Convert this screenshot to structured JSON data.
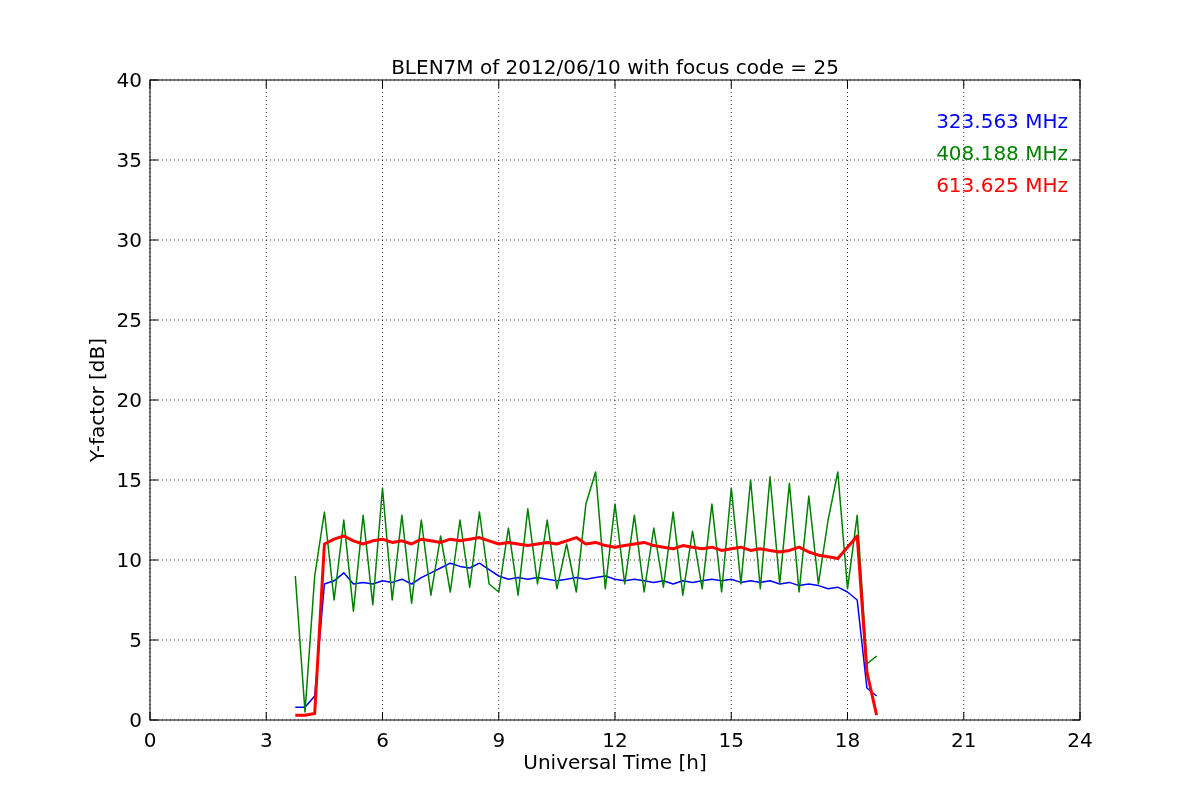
{
  "chart_data": {
    "type": "line",
    "title": "BLEN7M of 2012/06/10 with focus code = 25",
    "xlabel": "Universal Time [h]",
    "ylabel": "Y-factor [dB]",
    "x": [
      3.75,
      4.0,
      4.25,
      4.5,
      4.75,
      5.0,
      5.25,
      5.5,
      5.75,
      6.0,
      6.25,
      6.5,
      6.75,
      7.0,
      7.25,
      7.5,
      7.75,
      8.0,
      8.25,
      8.5,
      8.75,
      9.0,
      9.25,
      9.5,
      9.75,
      10.0,
      10.25,
      10.5,
      10.75,
      11.0,
      11.25,
      11.5,
      11.75,
      12.0,
      12.25,
      12.5,
      12.75,
      13.0,
      13.25,
      13.5,
      13.75,
      14.0,
      14.25,
      14.5,
      14.75,
      15.0,
      15.25,
      15.5,
      15.75,
      16.0,
      16.25,
      16.5,
      16.75,
      17.0,
      17.25,
      17.5,
      17.75,
      18.0,
      18.25,
      18.5,
      18.75
    ],
    "series": [
      {
        "name": "323.563 MHz",
        "color": "#0000ff",
        "values": [
          0.8,
          0.8,
          1.5,
          8.5,
          8.7,
          9.2,
          8.5,
          8.6,
          8.5,
          8.7,
          8.6,
          8.8,
          8.5,
          8.9,
          9.2,
          9.5,
          9.8,
          9.6,
          9.5,
          9.8,
          9.4,
          9.0,
          8.8,
          8.9,
          8.8,
          8.9,
          8.8,
          8.7,
          8.8,
          8.9,
          8.8,
          8.9,
          9.0,
          8.8,
          8.7,
          8.8,
          8.7,
          8.6,
          8.7,
          8.5,
          8.7,
          8.6,
          8.7,
          8.8,
          8.7,
          8.8,
          8.6,
          8.7,
          8.6,
          8.7,
          8.5,
          8.6,
          8.4,
          8.5,
          8.4,
          8.2,
          8.3,
          8.0,
          7.5,
          2.0,
          1.5
        ]
      },
      {
        "name": "408.188 MHz",
        "color": "#008000",
        "values": [
          9.0,
          0.5,
          9.0,
          13.0,
          7.5,
          12.5,
          6.8,
          12.8,
          7.2,
          14.5,
          7.5,
          12.8,
          7.3,
          12.5,
          7.8,
          11.5,
          8.0,
          12.5,
          8.3,
          13.0,
          8.5,
          8.0,
          12.0,
          7.8,
          13.2,
          8.5,
          12.5,
          8.2,
          11.0,
          8.0,
          13.5,
          15.5,
          8.2,
          13.5,
          8.5,
          12.8,
          8.0,
          12.0,
          8.3,
          13.0,
          7.8,
          11.8,
          8.2,
          13.5,
          8.0,
          14.5,
          8.5,
          15.0,
          8.2,
          15.2,
          8.5,
          14.8,
          8.0,
          14.0,
          8.5,
          12.5,
          15.5,
          8.2,
          12.8,
          3.5,
          4.0
        ]
      },
      {
        "name": "613.625 MHz",
        "color": "#ff0000",
        "values": [
          0.3,
          0.3,
          0.4,
          11.0,
          11.3,
          11.5,
          11.2,
          11.0,
          11.2,
          11.3,
          11.1,
          11.2,
          11.0,
          11.3,
          11.2,
          11.1,
          11.3,
          11.2,
          11.3,
          11.4,
          11.2,
          11.0,
          11.1,
          11.0,
          10.9,
          11.0,
          11.1,
          11.0,
          11.2,
          11.4,
          11.0,
          11.1,
          10.9,
          10.8,
          10.9,
          11.0,
          11.1,
          10.9,
          10.8,
          10.7,
          10.9,
          10.8,
          10.7,
          10.8,
          10.6,
          10.7,
          10.8,
          10.6,
          10.7,
          10.6,
          10.5,
          10.6,
          10.8,
          10.5,
          10.3,
          10.2,
          10.1,
          10.8,
          11.5,
          3.0,
          0.3
        ]
      }
    ],
    "grid": true,
    "xlim": [
      0,
      24
    ],
    "ylim": [
      0,
      40
    ],
    "xticks": [
      0,
      3,
      6,
      9,
      12,
      15,
      18,
      21,
      24
    ],
    "yticks": [
      0,
      5,
      10,
      15,
      20,
      25,
      30,
      35,
      40
    ]
  }
}
